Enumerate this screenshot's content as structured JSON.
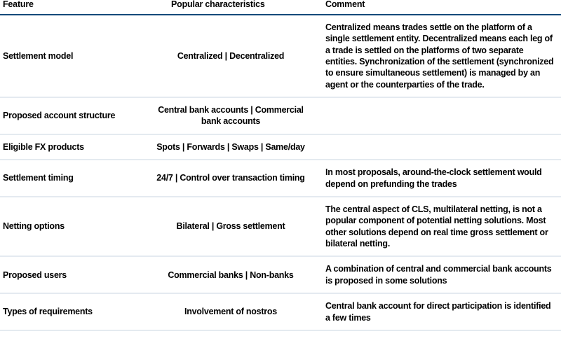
{
  "table": {
    "headers": {
      "feature": "Feature",
      "characteristics": "Popular characteristics",
      "comment": "Comment"
    },
    "accent_rule_color": "#154a7a",
    "row_divider_color": "#e4eaf0",
    "rows": [
      {
        "feature": "Settlement model",
        "characteristics": "Centralized | Decentralized",
        "comment": "Centralized means trades settle on the platform of a single settlement entity. Decentralized means each leg of a trade is settled on the platforms of two separate entities. Synchronization of the settlement (synchronized to ensure simultaneous settlement) is managed by an agent or the counterparties of the trade."
      },
      {
        "feature": "Proposed account structure",
        "characteristics": "Central bank accounts | Commercial bank accounts",
        "comment": ""
      },
      {
        "feature": "Eligible FX products",
        "characteristics": "Spots | Forwards | Swaps | Same/day",
        "comment": ""
      },
      {
        "feature": "Settlement timing",
        "characteristics": "24/7 | Control over transaction timing",
        "comment": "In most proposals, around-the-clock settlement would depend on prefunding the trades"
      },
      {
        "feature": "Netting options",
        "characteristics": "Bilateral | Gross settlement",
        "comment": "The central aspect of CLS, multilateral netting, is not a popular component of potential netting solutions. Most other solutions depend on real time gross settlement or bilateral netting."
      },
      {
        "feature": "Proposed users",
        "characteristics": "Commercial banks | Non-banks",
        "comment": "A combination of central and commercial bank accounts is proposed in some solutions"
      },
      {
        "feature": "Types of requirements",
        "characteristics": "Involvement of nostros",
        "comment": "Central bank account for direct participation is identified a few times"
      }
    ]
  }
}
